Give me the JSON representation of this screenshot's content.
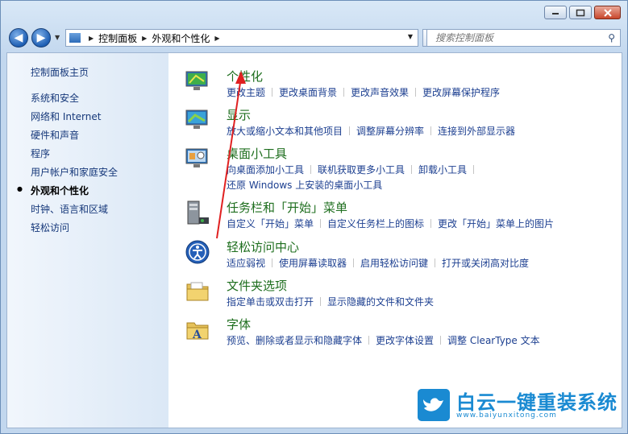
{
  "address": {
    "crumbs": [
      "控制面板",
      "外观和个性化"
    ]
  },
  "search": {
    "placeholder": "搜索控制面板"
  },
  "sidebar": {
    "home": "控制面板主页",
    "items": [
      {
        "label": "系统和安全"
      },
      {
        "label": "网络和 Internet"
      },
      {
        "label": "硬件和声音"
      },
      {
        "label": "程序"
      },
      {
        "label": "用户帐户和家庭安全"
      },
      {
        "label": "外观和个性化",
        "active": true
      },
      {
        "label": "时钟、语言和区域"
      },
      {
        "label": "轻松访问"
      }
    ]
  },
  "categories": [
    {
      "title": "个性化",
      "links": [
        "更改主题",
        "更改桌面背景",
        "更改声音效果",
        "更改屏幕保护程序"
      ]
    },
    {
      "title": "显示",
      "links": [
        "放大或缩小文本和其他项目",
        "调整屏幕分辨率",
        "连接到外部显示器"
      ]
    },
    {
      "title": "桌面小工具",
      "links": [
        "向桌面添加小工具",
        "联机获取更多小工具",
        "卸载小工具"
      ],
      "links2": [
        "还原 Windows 上安装的桌面小工具"
      ]
    },
    {
      "title": "任务栏和「开始」菜单",
      "links": [
        "自定义「开始」菜单",
        "自定义任务栏上的图标",
        "更改「开始」菜单上的图片"
      ]
    },
    {
      "title": "轻松访问中心",
      "links": [
        "适应弱视",
        "使用屏幕读取器",
        "启用轻松访问键",
        "打开或关闭高对比度"
      ]
    },
    {
      "title": "文件夹选项",
      "links": [
        "指定单击或双击打开",
        "显示隐藏的文件和文件夹"
      ]
    },
    {
      "title": "字体",
      "links": [
        "预览、删除或者显示和隐藏字体",
        "更改字体设置",
        "调整 ClearType 文本"
      ]
    }
  ],
  "watermark": {
    "text": "白云一键重装系统",
    "url": "www.baiyunxitong.com"
  },
  "colors": {
    "link": "#1c3f90",
    "category_title": "#1e6e1e",
    "accent": "#1a8ad2"
  }
}
